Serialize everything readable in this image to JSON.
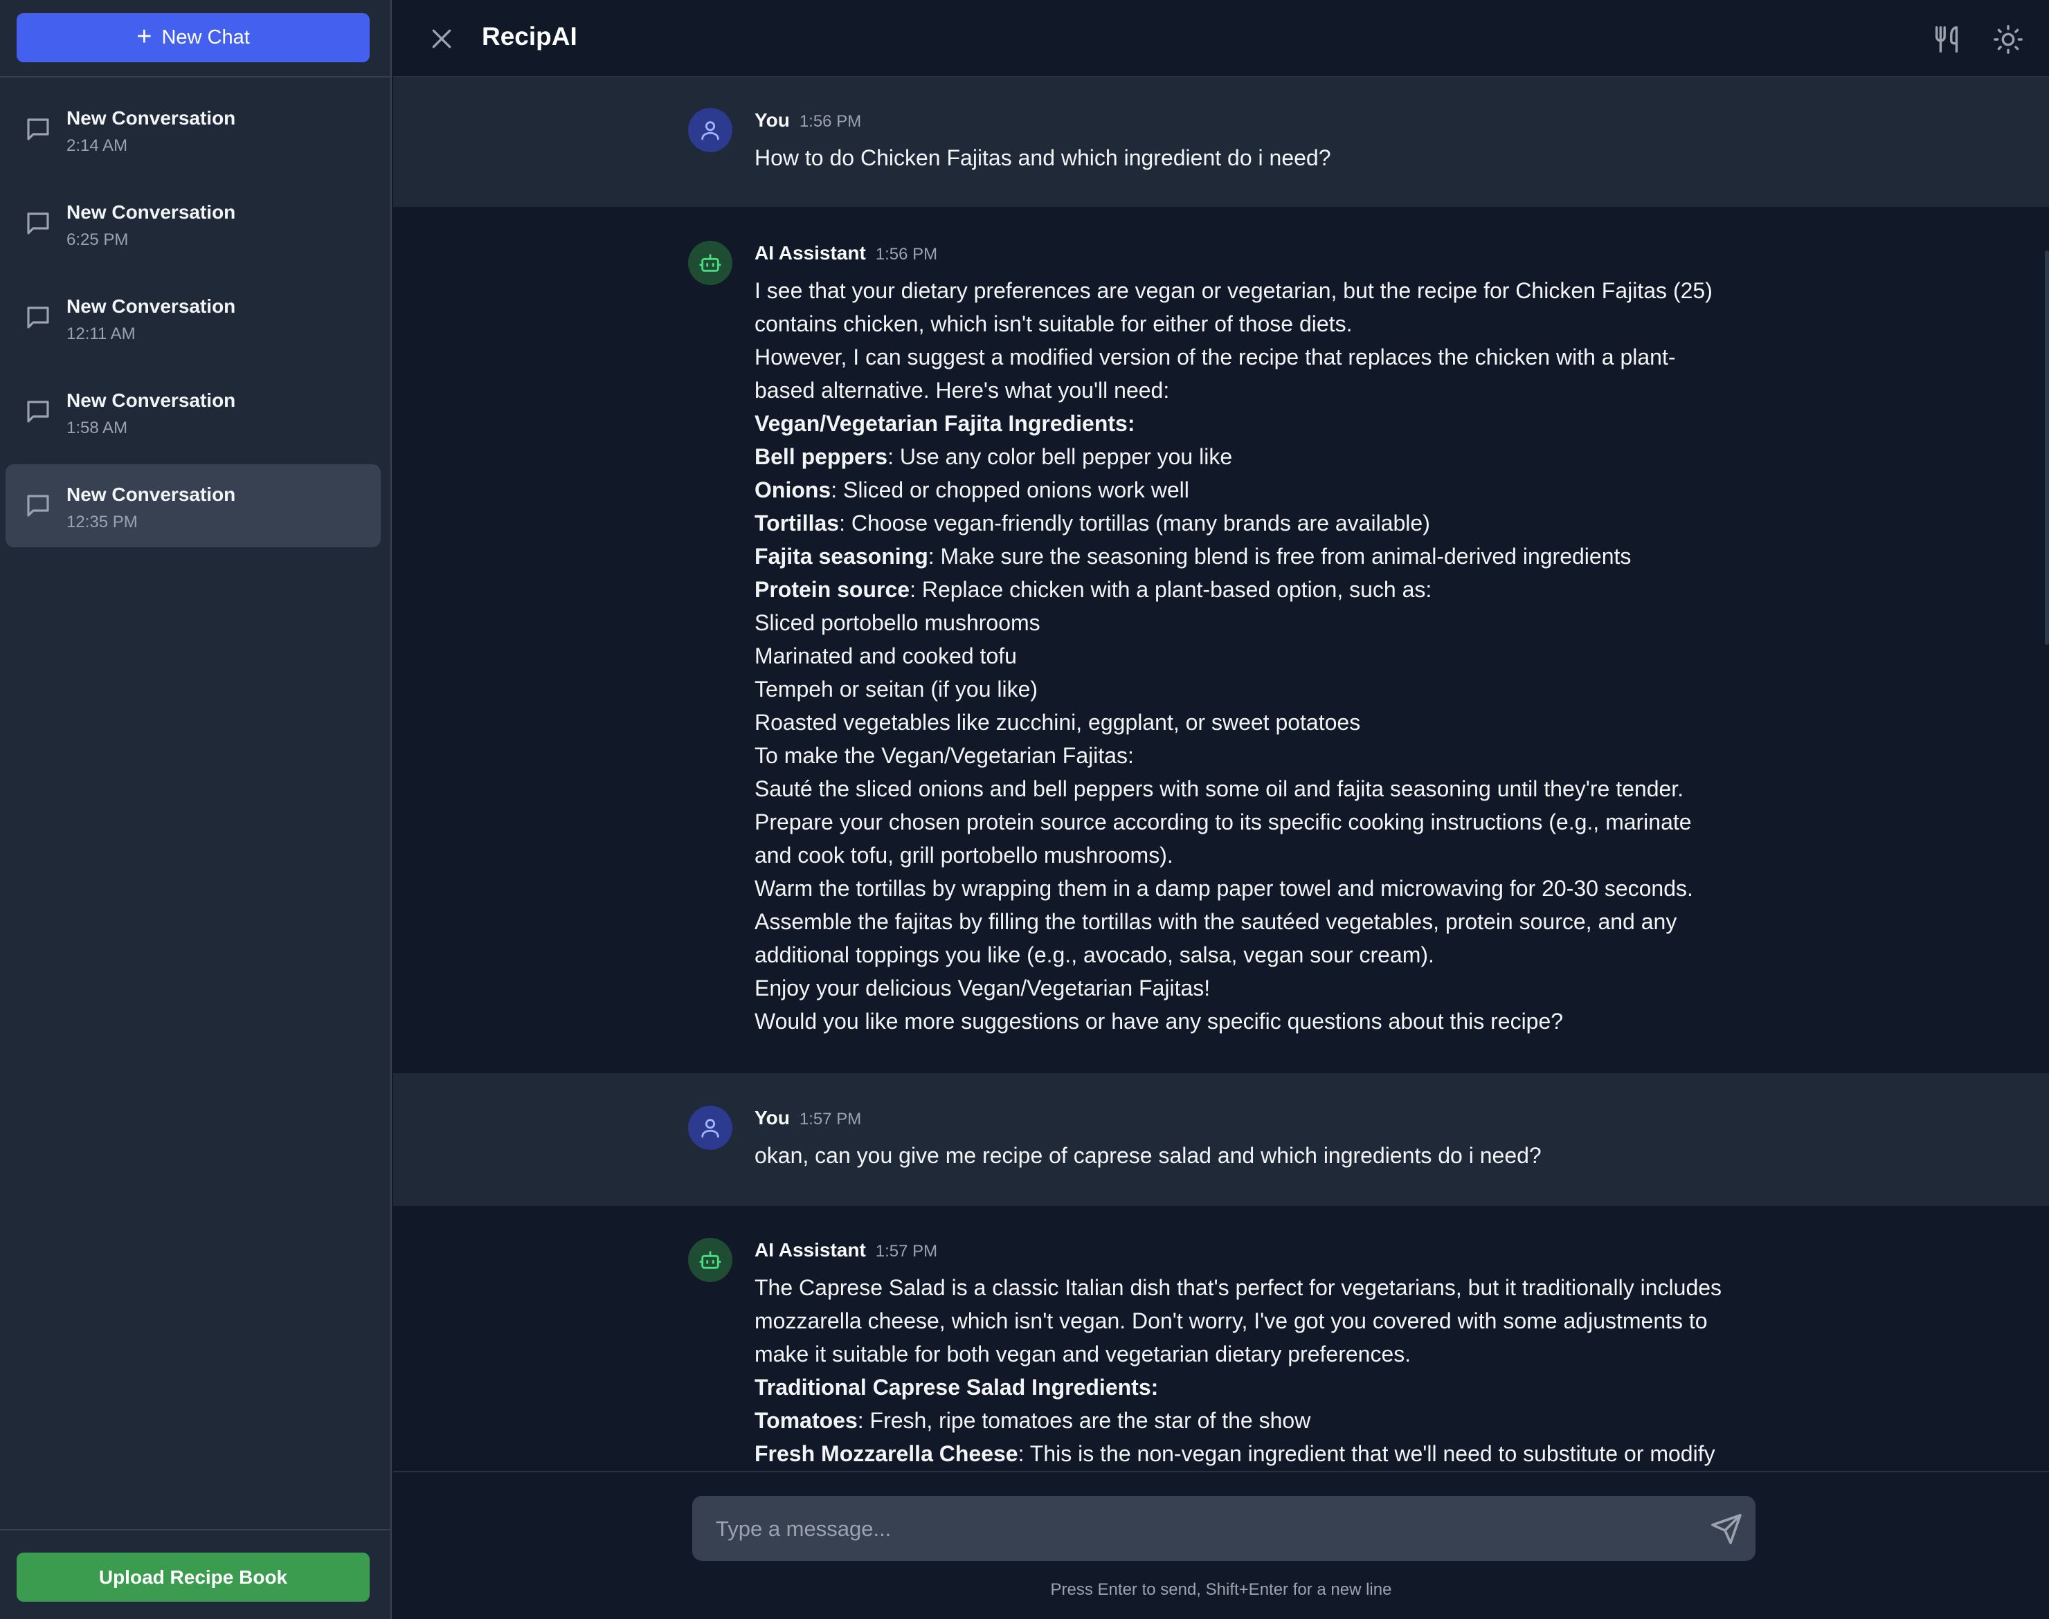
{
  "sidebar": {
    "new_chat_label": "New Chat",
    "conversations": [
      {
        "title": "New Conversation",
        "time": "2:14 AM"
      },
      {
        "title": "New Conversation",
        "time": "6:25 PM"
      },
      {
        "title": "New Conversation",
        "time": "12:11 AM"
      },
      {
        "title": "New Conversation",
        "time": "1:58 AM"
      },
      {
        "title": "New Conversation",
        "time": "12:35 PM",
        "active": true
      }
    ],
    "upload_label": "Upload Recipe Book"
  },
  "header": {
    "title": "RecipAI",
    "icons": [
      "close-icon",
      "utensils-icon",
      "sun-icon"
    ]
  },
  "messages": [
    {
      "sender": "You",
      "time": "1:56 PM",
      "lines": [
        "How to do Chicken Fajitas and which ingredient do i need?"
      ]
    },
    {
      "sender": "AI Assistant",
      "time": "1:56 PM",
      "lines": [
        "I see that your dietary preferences are vegan or vegetarian, but the recipe for Chicken Fajitas (25)",
        "contains chicken, which isn't suitable for either of those diets.",
        "However, I can suggest a modified version of the recipe that replaces the chicken with a plant-",
        "based alternative. Here's what you'll need:",
        "Vegan/Vegetarian Fajita Ingredients:",
        "Use any color bell pepper you like",
        "Sliced or chopped onions work well",
        "Choose vegan-friendly tortillas (many brands are available)",
        "Make sure the seasoning blend is free from animal-derived ingredients",
        "Replace chicken with a plant-based option, such as:",
        "Sliced portobello mushrooms",
        "Marinated and cooked tofu",
        "Tempeh or seitan (if you like)",
        "Roasted vegetables like zucchini, eggplant, or sweet potatoes",
        "To make the Vegan/Vegetarian Fajitas:",
        "Sauté the sliced onions and bell peppers with some oil and fajita seasoning until they're tender.",
        "Prepare your chosen protein source according to its specific cooking instructions (e.g., marinate",
        "and cook tofu, grill portobello mushrooms).",
        "Warm the tortillas by wrapping them in a damp paper towel and microwaving for 20-30 seconds.",
        "Assemble the fajitas by filling the tortillas with the sautéed vegetables, protein source, and any",
        "additional toppings you like (e.g., avocado, salsa, vegan sour cream).",
        "Enjoy your delicious Vegan/Vegetarian Fajitas!",
        "Would you like more suggestions or have any specific questions about this recipe?"
      ],
      "bold_terms": [
        "Bell peppers",
        "Onions",
        "Tortillas",
        "Fajita seasoning",
        "Protein source"
      ]
    },
    {
      "sender": "You",
      "time": "1:57 PM",
      "lines": [
        "okan, can you give me recipe of caprese salad and which ingredients do i need?"
      ]
    },
    {
      "sender": "AI Assistant",
      "time": "1:57 PM",
      "lines": [
        "The Caprese Salad is a classic Italian dish that's perfect for vegetarians, but it traditionally includes",
        "mozzarella cheese, which isn't vegan. Don't worry, I've got you covered with some adjustments to",
        "make it suitable for both vegan and vegetarian dietary preferences.",
        "Traditional Caprese Salad Ingredients:",
        "Fresh, ripe tomatoes are the star of the show",
        "This is the non-vegan ingredient that we'll need to substitute or modify"
      ],
      "bold_terms": [
        "Tomatoes",
        "Fresh Mozzarella Cheese"
      ]
    }
  ],
  "input": {
    "placeholder": "Type a message...",
    "hint": "Press Enter to send, Shift+Enter for a new line"
  },
  "colors": {
    "primary": "#4361ee",
    "upload": "#3b9b4f",
    "sidebar_bg": "#1f2937",
    "main_bg": "#111827"
  }
}
